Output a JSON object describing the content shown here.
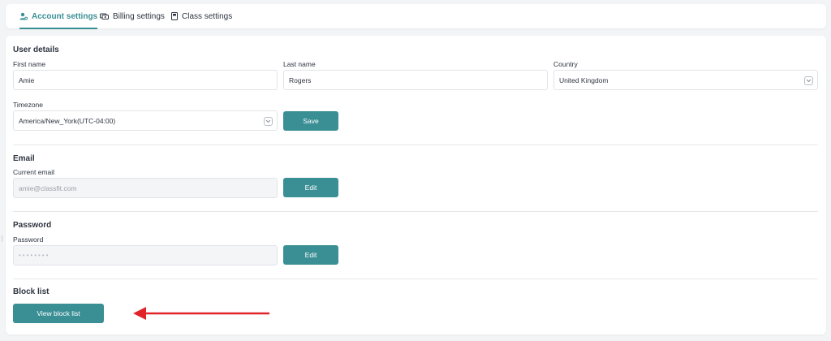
{
  "tabs": [
    {
      "label": "Account settings",
      "icon": "user-gear-icon",
      "active": true
    },
    {
      "label": "Billing settings",
      "icon": "billing-icon",
      "active": false
    },
    {
      "label": "Class settings",
      "icon": "book-icon",
      "active": false
    }
  ],
  "user_details": {
    "title": "User details",
    "first_name": {
      "label": "First name",
      "value": "Amie"
    },
    "last_name": {
      "label": "Last name",
      "value": "Rogers"
    },
    "country": {
      "label": "Country",
      "value": "United Kingdom"
    },
    "timezone": {
      "label": "Timezone",
      "value": "America/New_York(UTC-04:00)"
    },
    "save_label": "Save"
  },
  "email": {
    "title": "Email",
    "field_label": "Current email",
    "value": "amie@classfit.com",
    "edit_label": "Edit"
  },
  "password": {
    "title": "Password",
    "field_label": "Password",
    "value": "••••••••",
    "edit_label": "Edit"
  },
  "block_list": {
    "title": "Block list",
    "button_label": "View block list"
  },
  "colors": {
    "accent": "#3a8f95",
    "annotation_arrow": "#e0242a"
  }
}
